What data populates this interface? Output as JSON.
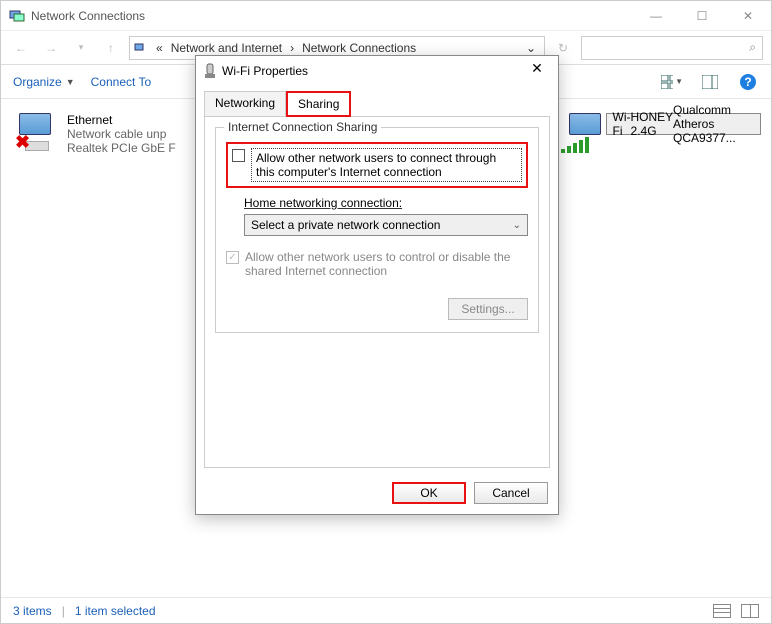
{
  "window": {
    "title": "Network Connections",
    "breadcrumb": [
      "Network and Internet",
      "Network Connections"
    ]
  },
  "toolbar": {
    "organize": "Organize",
    "connect": "Connect To"
  },
  "items": [
    {
      "name": "Ethernet",
      "line1": "Network cable unp",
      "line2": "Realtek PCIe GbE F"
    },
    {
      "name": "Wi-Fi",
      "line1": "HONEY 2.4G",
      "line2": "Qualcomm Atheros QCA9377..."
    }
  ],
  "status": {
    "count": "3 items",
    "sel": "1 item selected"
  },
  "dialog": {
    "title": "Wi-Fi Properties",
    "tabs": [
      "Networking",
      "Sharing"
    ],
    "group_legend": "Internet Connection Sharing",
    "allow_connect": "Allow other network users to connect through this computer's Internet connection",
    "home_label": "Home networking connection:",
    "home_select": "Select a private network connection",
    "allow_control": "Allow other network users to control or disable the shared Internet connection",
    "settings_btn": "Settings...",
    "ok": "OK",
    "cancel": "Cancel"
  }
}
